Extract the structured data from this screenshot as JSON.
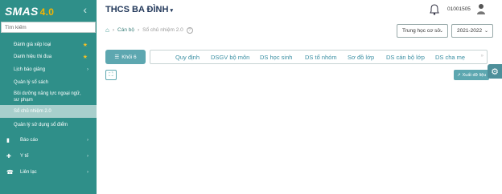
{
  "logo": {
    "main": "SMAS",
    "version": "4.0"
  },
  "sidebar": {
    "search_placeholder": "Tìm kiếm",
    "items": [
      {
        "label": "Đánh giá xếp loại",
        "star": true
      },
      {
        "label": "Danh hiệu thi đua",
        "star": true
      },
      {
        "label": "Lịch báo giảng"
      },
      {
        "label": "Quản lý sổ sách"
      },
      {
        "label": "Bồi dưỡng năng lực ngoại ngữ, sư phạm"
      },
      {
        "label": "Sổ chủ nhiệm 2.0"
      },
      {
        "label": "Quản lý sử dụng sổ điểm"
      },
      {
        "label": "Báo cáo"
      },
      {
        "label": "Y tế"
      },
      {
        "label": "Liên lạc"
      }
    ]
  },
  "header": {
    "school": "THCS BA ĐÌNH",
    "user_id": "01001505"
  },
  "breadcrumb": {
    "level1": "Cán bộ",
    "current": "Sổ chủ nhiệm 2.0",
    "help": "?"
  },
  "filters": {
    "level": "Trung học cơ sở",
    "year": "2021-2022"
  },
  "grade_button": "Khối 6",
  "tabs": [
    "Quy định",
    "DSGV bộ môn",
    "DS học sinh",
    "DS tổ nhóm",
    "Sơ đồ lớp",
    "DS cán bộ lớp",
    "DS cha mẹ"
  ],
  "export_label": "Xuất dữ liệu",
  "colors": {
    "sidebar": "#2f8f89",
    "accent": "#5da7b0",
    "active": "#a8cfcc",
    "star": "#f5c024"
  }
}
